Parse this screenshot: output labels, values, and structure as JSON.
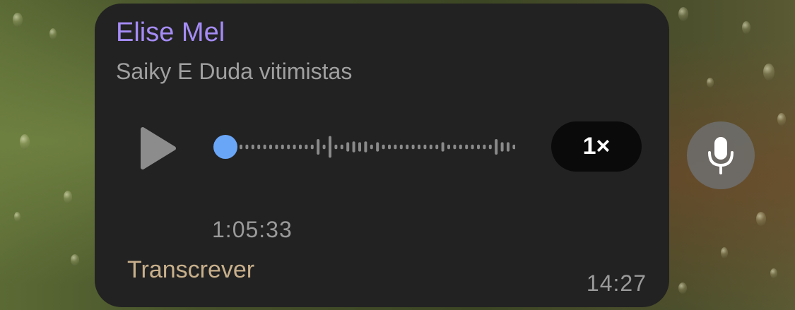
{
  "message": {
    "sender": "Elise Mel",
    "subtitle": "Saiky E Duda vitimistas",
    "duration": "1:05:33",
    "transcribe_label": "Transcrever",
    "timestamp": "14:27",
    "playback_progress": 0
  },
  "controls": {
    "speed_label": "1×"
  },
  "icons": {
    "play": "play-icon",
    "mic": "microphone-icon"
  },
  "colors": {
    "sender": "#a58cf6",
    "transcribe": "#c8b08c",
    "progress_knob": "#6aa6f8",
    "bubble": "#222222"
  }
}
